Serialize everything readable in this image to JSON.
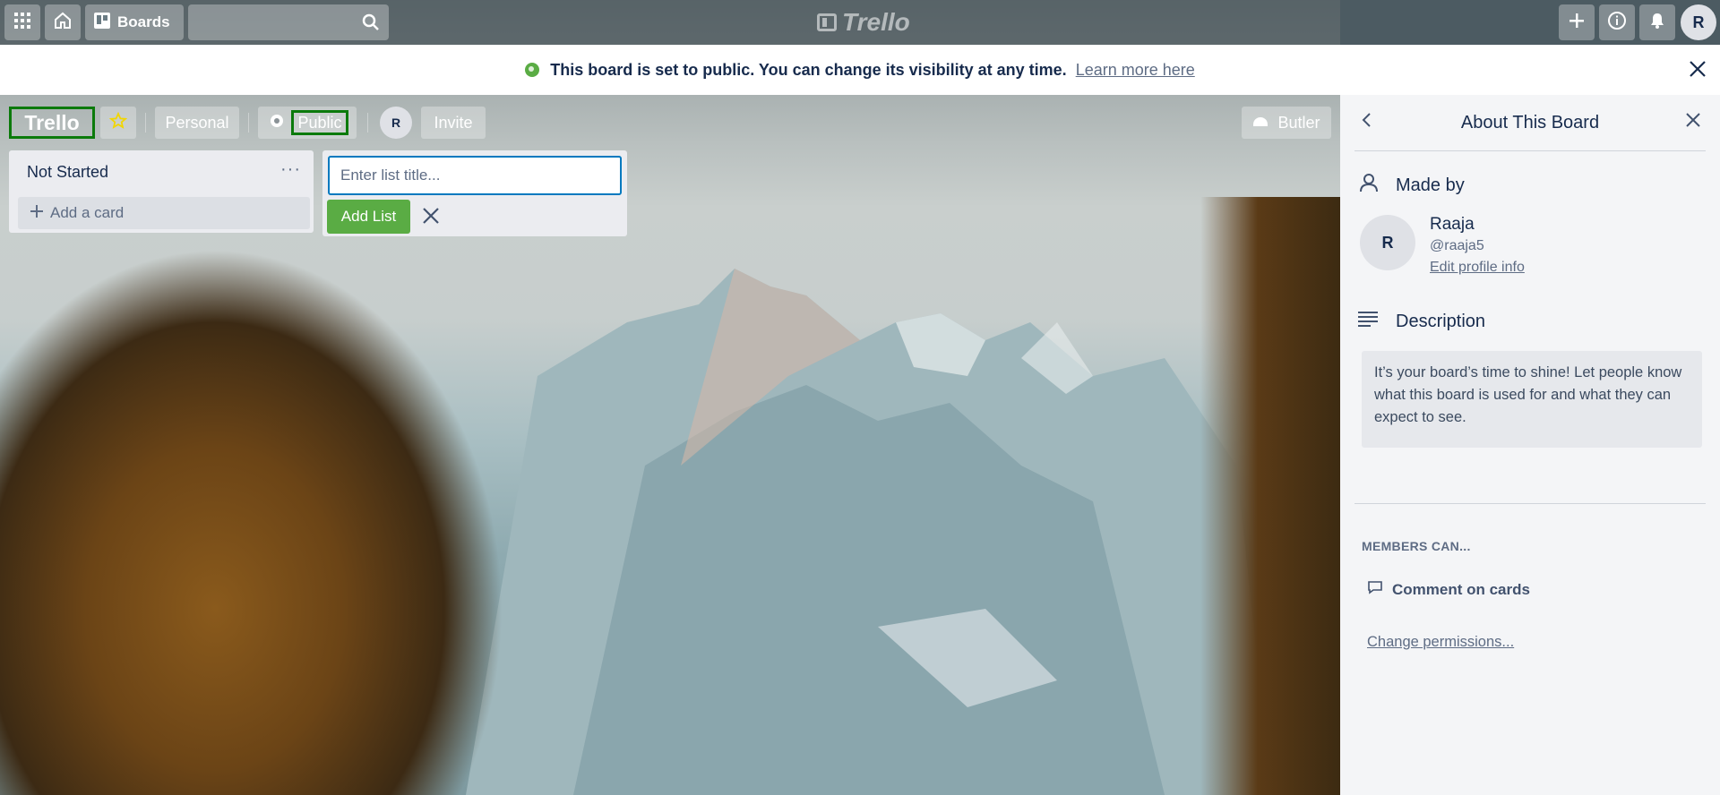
{
  "header": {
    "boards_label": "Boards",
    "search_placeholder": "",
    "logo_text": "Trello",
    "user_initial": "R"
  },
  "banner": {
    "message": "This board is set to public. You can change its visibility at any time.",
    "link": "Learn more here"
  },
  "board": {
    "title": "Trello",
    "team": "Personal",
    "visibility": "Public",
    "member_initial": "R",
    "invite": "Invite",
    "butler": "Butler"
  },
  "lists": [
    {
      "title": "Not Started",
      "add_card": "Add a card"
    }
  ],
  "add_list": {
    "placeholder": "Enter list title...",
    "button": "Add List"
  },
  "sidebar": {
    "title": "About This Board",
    "made_by_label": "Made by",
    "member": {
      "initial": "R",
      "name": "Raaja",
      "handle": "@raaja5",
      "edit": "Edit profile info"
    },
    "description_label": "Description",
    "description_text": "It’s your board’s time to shine! Let people know what this board is used for and what they can expect to see.",
    "members_can_label": "MEMBERS CAN...",
    "permission": "Comment on cards",
    "change_permissions": "Change permissions..."
  },
  "colors": {
    "accent_green": "#5aac44",
    "highlight_border": "#0b7a0b",
    "input_focus": "#0079bf"
  }
}
